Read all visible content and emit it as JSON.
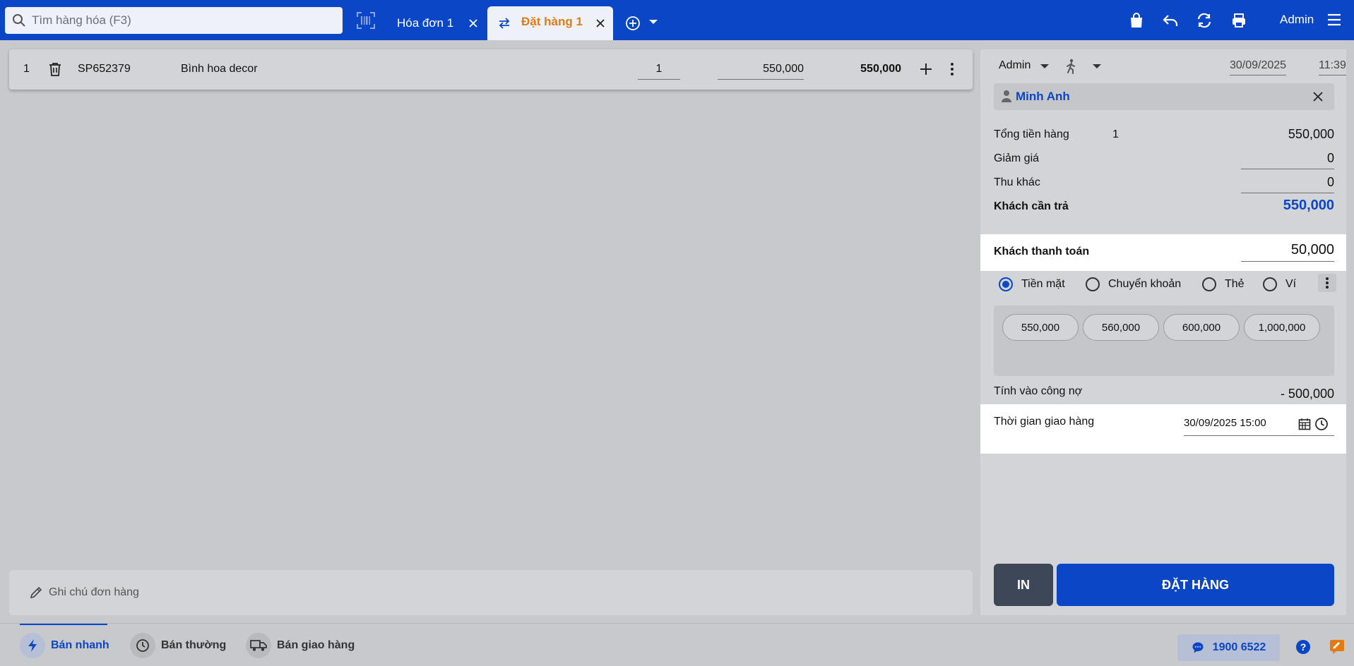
{
  "search": {
    "placeholder": "Tìm hàng hóa (F3)"
  },
  "tabs": [
    {
      "label": "Hóa đơn 1",
      "active": false
    },
    {
      "label": "Đặt hàng 1",
      "active": true
    }
  ],
  "header": {
    "user": "Admin"
  },
  "order_items": [
    {
      "index": "1",
      "code": "SP652379",
      "name": "Bình hoa decor",
      "qty": "1",
      "price": "550,000",
      "total": "550,000"
    }
  ],
  "note": {
    "placeholder": "Ghi chú đơn hàng"
  },
  "panel": {
    "seller": "Admin",
    "date": "30/09/2025",
    "time": "11:39",
    "customer": "Minh Anh",
    "subtotal": {
      "label": "Tổng tiền hàng",
      "count": "1",
      "value": "550,000"
    },
    "discount": {
      "label": "Giảm giá",
      "value": "0"
    },
    "other_fee": {
      "label": "Thu khác",
      "value": "0"
    },
    "due": {
      "label": "Khách cần trả",
      "value": "550,000"
    },
    "paid": {
      "label": "Khách thanh toán",
      "value": "50,000"
    },
    "methods": [
      {
        "label": "Tiền mặt",
        "selected": true
      },
      {
        "label": "Chuyển khoản",
        "selected": false
      },
      {
        "label": "Thẻ",
        "selected": false
      },
      {
        "label": "Ví",
        "selected": false
      }
    ],
    "quick_amounts": [
      "550,000",
      "560,000",
      "600,000",
      "1,000,000"
    ],
    "debt": {
      "label": "Tính vào công nợ",
      "value": "- 500,000"
    },
    "delivery": {
      "label": "Thời gian giao hàng",
      "value": "30/09/2025 15:00"
    },
    "print_label": "IN",
    "order_label": "ĐẶT HÀNG"
  },
  "bottom": {
    "modes": [
      {
        "label": "Bán nhanh",
        "active": true
      },
      {
        "label": "Bán thường",
        "active": false
      },
      {
        "label": "Bán giao hàng",
        "active": false
      }
    ],
    "hotline": "1900 6522"
  },
  "colors": {
    "brand": "#0b46c7",
    "active_tab_text": "#e37b12",
    "print_button": "#3d4757"
  }
}
